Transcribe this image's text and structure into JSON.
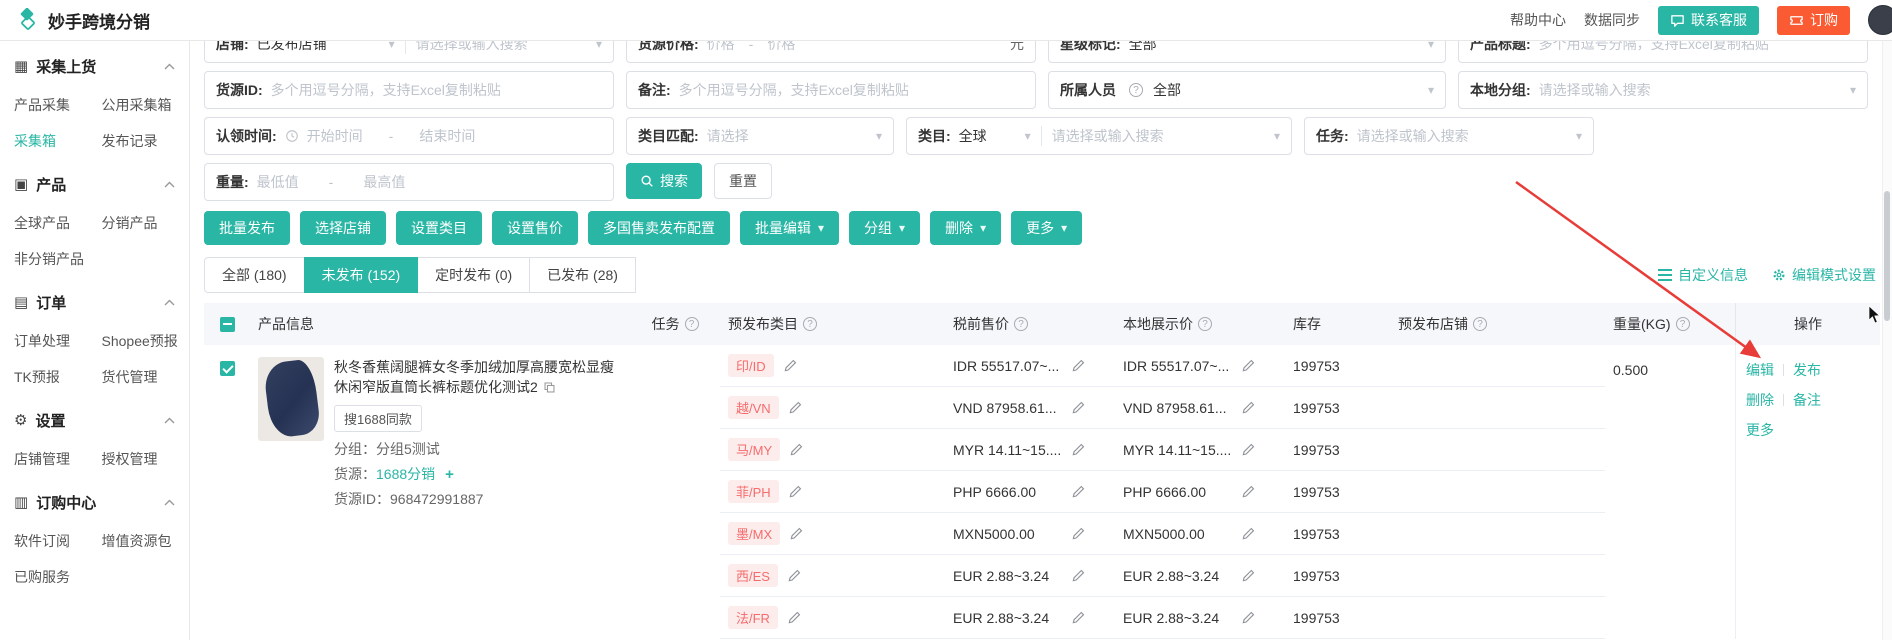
{
  "colors": {
    "accent": "#29b6a5",
    "orange": "#fb5b32",
    "tag_bg": "#fdecec",
    "tag_text": "#f56c6c",
    "arrow": "#e83c38"
  },
  "icons": {
    "help": "?",
    "caret_down": "▾",
    "collect": "▦",
    "product": "▣",
    "order": "▤",
    "settings": "⚙",
    "purchase": "▥",
    "plus": "+"
  },
  "header": {
    "title": "妙手跨境分销",
    "help_link": "帮助中心",
    "sync_link": "数据同步",
    "contact_button": "联系客服",
    "order_button": "订购"
  },
  "sidebar": {
    "sections": [
      {
        "title": "采集上货",
        "items": [
          "产品采集",
          "公用采集箱",
          "采集箱",
          "发布记录"
        ]
      },
      {
        "title": "产品",
        "items": [
          "全球产品",
          "分销产品",
          "非分销产品"
        ]
      },
      {
        "title": "订单",
        "items": [
          "订单处理",
          "Shopee预报",
          "TK预报",
          "货代管理"
        ]
      },
      {
        "title": "设置",
        "items": [
          "店铺管理",
          "授权管理"
        ]
      },
      {
        "title": "订购中心",
        "items": [
          "软件订阅",
          "增值资源包",
          "已购服务"
        ]
      }
    ]
  },
  "filters": {
    "range_separator": "-",
    "row1": {
      "shop_label": "店铺:",
      "shop_value": "已发布店铺",
      "shop_placeholder": "请选择或输入搜索",
      "price_label": "货源价格:",
      "price_min": "价格",
      "price_max": "价格",
      "price_unit": "元",
      "star_label": "星级标记:",
      "star_value": "全部",
      "title_label": "产品标题:",
      "title_placeholder": "多个用逗号分隔，支持Excel复制粘贴"
    },
    "row2": {
      "source_id_label": "货源ID:",
      "source_id_placeholder": "多个用逗号分隔，支持Excel复制粘贴",
      "remark_label": "备注:",
      "remark_placeholder": "多个用逗号分隔，支持Excel复制粘贴",
      "owner_label": "所属人员",
      "owner_value": "全部",
      "group_label": "本地分组:",
      "group_placeholder": "请选择或输入搜索"
    },
    "row3": {
      "claim_label": "认领时间:",
      "start_placeholder": "开始时间",
      "end_placeholder": "结束时间",
      "match_label": "类目匹配:",
      "match_placeholder": "请选择",
      "category_label": "类目:",
      "category_scope": "全球",
      "category_placeholder": "请选择或输入搜索",
      "task_label": "任务:",
      "task_placeholder": "请选择或输入搜索"
    },
    "row4": {
      "weight_label": "重量:",
      "weight_min": "最低值",
      "weight_max": "最高值",
      "search_button": "搜索",
      "reset_button": "重置"
    }
  },
  "toolbar": {
    "batch_publish": "批量发布",
    "select_shop": "选择店铺",
    "set_category": "设置类目",
    "set_price": "设置售价",
    "multi_country_config": "多国售卖发布配置",
    "batch_edit": "批量编辑",
    "group": "分组",
    "delete": "删除",
    "more": "更多"
  },
  "tabs": {
    "all": "全部 (180)",
    "unpublished": "未发布 (152)",
    "scheduled": "定时发布 (0)",
    "published": "已发布 (28)"
  },
  "view_links": {
    "custom_info": "自定义信息",
    "edit_mode_settings": "编辑模式设置"
  },
  "table": {
    "col_product": "产品信息",
    "col_task": "任务",
    "col_category": "预发布类目",
    "col_price": "税前售价",
    "col_local_price": "本地展示价",
    "col_stock": "库存",
    "col_shop": "预发布店铺",
    "col_weight": "重量(KG)",
    "col_ops": "操作"
  },
  "product": {
    "title": "秋冬香蕉阔腿裤女冬季加绒加厚高腰宽松显瘦休闲窄版直筒长裤标题优化测试2",
    "search_same_button": "搜1688同款",
    "group_label": "分组：",
    "group_value": "分组5测试",
    "source_label": "货源：",
    "source_value": "1688分销",
    "source_id_label": "货源ID：",
    "source_id_value": "968472991887",
    "weight": "0.500",
    "variants": [
      {
        "tag": "印/ID",
        "price": "IDR 55517.07~...",
        "local_price": "IDR 55517.07~...",
        "stock": "199753"
      },
      {
        "tag": "越/VN",
        "price": "VND 87958.61...",
        "local_price": "VND 87958.61...",
        "stock": "199753"
      },
      {
        "tag": "马/MY",
        "price": "MYR 14.11~15....",
        "local_price": "MYR 14.11~15....",
        "stock": "199753"
      },
      {
        "tag": "菲/PH",
        "price": "PHP 6666.00",
        "local_price": "PHP 6666.00",
        "stock": "199753"
      },
      {
        "tag": "墨/MX",
        "price": "MXN5000.00",
        "local_price": "MXN5000.00",
        "stock": "199753"
      },
      {
        "tag": "西/ES",
        "price": "EUR 2.88~3.24",
        "local_price": "EUR 2.88~3.24",
        "stock": "199753"
      },
      {
        "tag": "法/FR",
        "price": "EUR 2.88~3.24",
        "local_price": "EUR 2.88~3.24",
        "stock": "199753"
      }
    ],
    "ops": {
      "edit": "编辑",
      "publish": "发布",
      "delete": "删除",
      "remark": "备注",
      "more": "更多"
    }
  }
}
